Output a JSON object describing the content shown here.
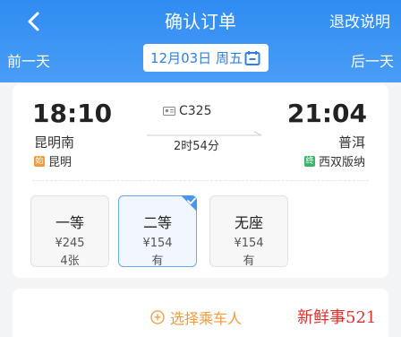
{
  "header": {
    "title": "确认订单",
    "refund_label": "退改说明",
    "prev_day": "前一天",
    "next_day": "后一天",
    "date": "12月03日 周五",
    "back_icon": "chevron-left-icon",
    "calendar_icon": "calendar-icon",
    "accent": "#2f8cf3"
  },
  "trip": {
    "dep_time": "18:10",
    "arr_time": "21:04",
    "dep_station": "昆明南",
    "arr_station": "普洱",
    "dep_city": "昆明",
    "arr_city": "西双版纳",
    "dep_badge": "始",
    "arr_badge": "终",
    "train_no": "C325",
    "duration": "2时54分"
  },
  "seats": [
    {
      "class": "一等",
      "price": "¥245",
      "availability": "4张",
      "selected": false
    },
    {
      "class": "二等",
      "price": "¥154",
      "availability": "有",
      "selected": true
    },
    {
      "class": "无座",
      "price": "¥154",
      "availability": "有",
      "selected": false
    }
  ],
  "passenger": {
    "select_label": "选择乘车人",
    "icon": "plus-circle-icon",
    "color": "#f29a3c"
  },
  "watermark": "新鲜事521"
}
